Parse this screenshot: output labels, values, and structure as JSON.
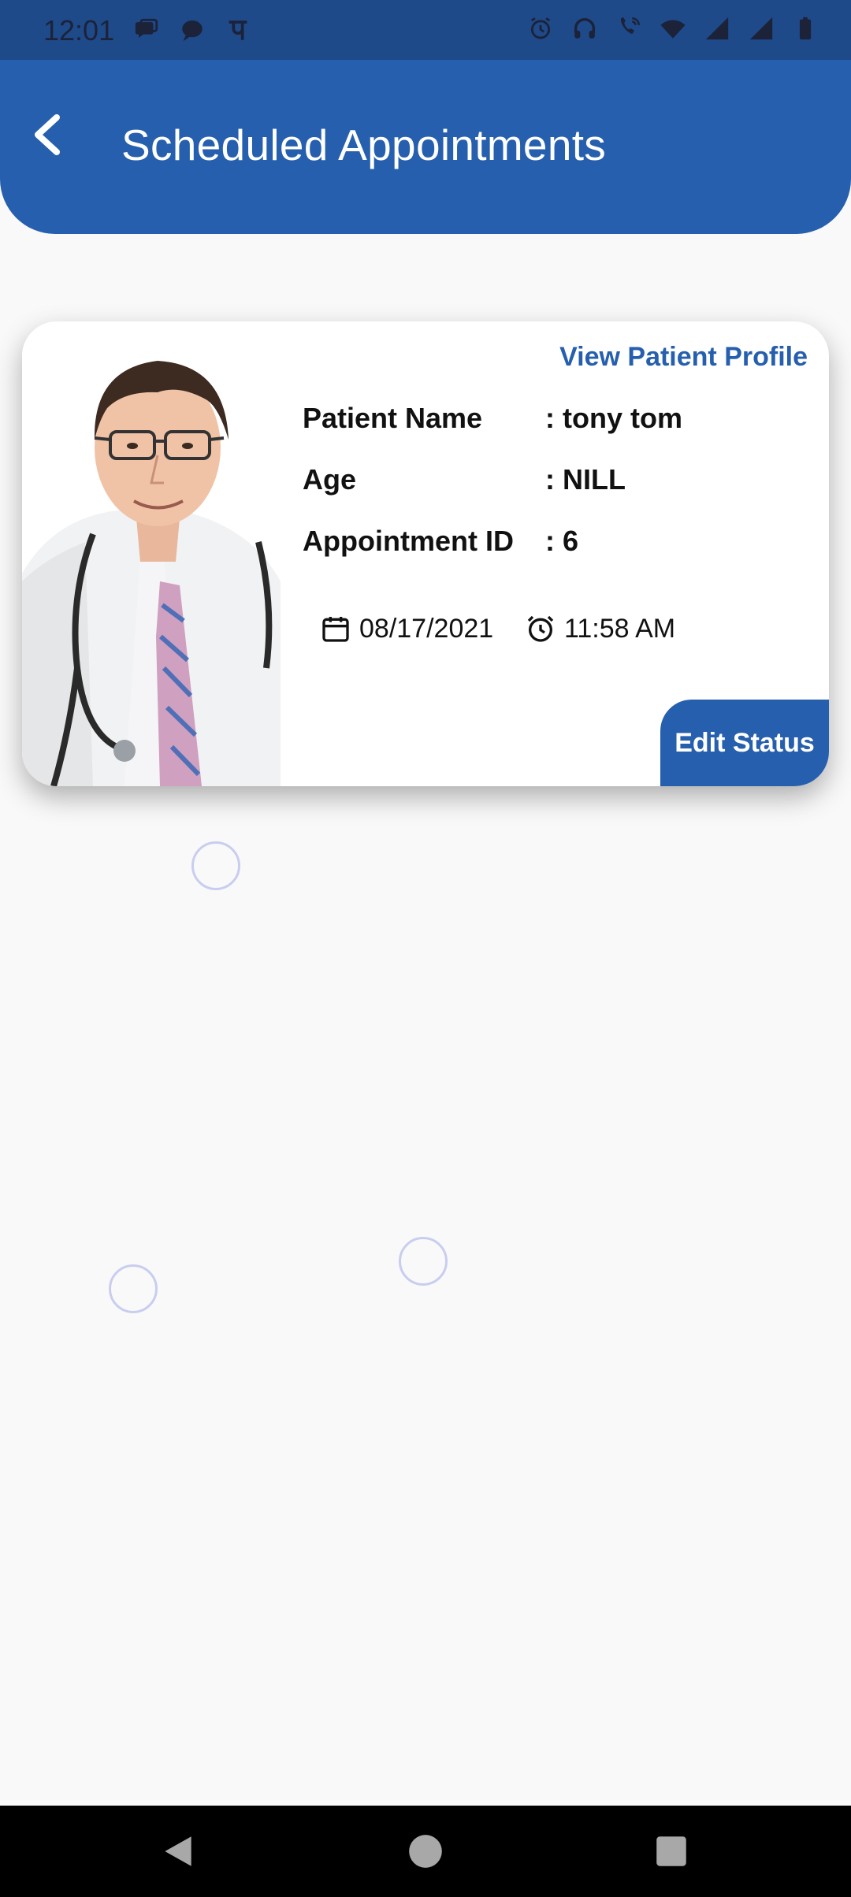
{
  "status_bar": {
    "time": "12:01",
    "left_icons": [
      "message-icon",
      "chat-bubble-icon",
      "phonepe-icon"
    ],
    "right_icons": [
      "alarm-icon",
      "headphones-icon",
      "wifi-call-icon",
      "wifi-icon",
      "signal-icon",
      "signal-icon",
      "battery-icon"
    ]
  },
  "app_bar": {
    "title": "Scheduled Appointments",
    "back_icon": "chevron-left-icon"
  },
  "appointment_card": {
    "view_profile_label": "View Patient Profile",
    "fields": [
      {
        "label": "Patient Name",
        "value": ": tony tom"
      },
      {
        "label": "Age",
        "value": ": NILL"
      },
      {
        "label": "Appointment ID",
        "value": ": 6"
      }
    ],
    "date": "08/17/2021",
    "time": "11:58 AM",
    "date_icon": "calendar-icon",
    "time_icon": "alarm-clock-icon",
    "edit_status_label": "Edit Status"
  },
  "colors": {
    "primary": "#265fad",
    "status_bar": "#1e4a8a",
    "background": "#f9f9f9",
    "loader_ring": "#c9cdf0"
  },
  "nav_bar": {
    "buttons": [
      "back-triangle-icon",
      "home-circle-icon",
      "recents-square-icon"
    ]
  }
}
